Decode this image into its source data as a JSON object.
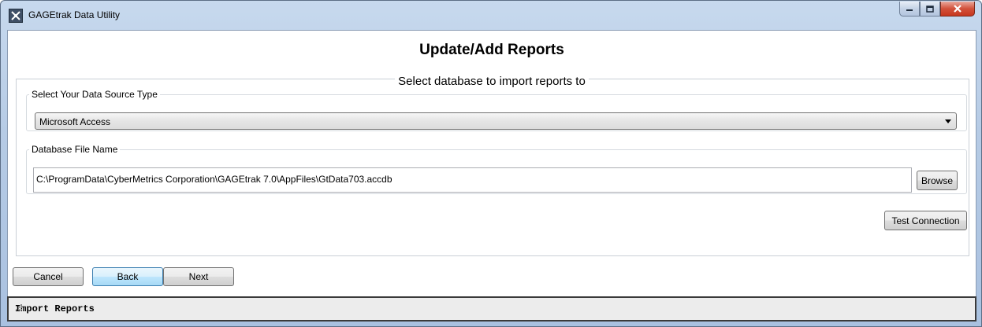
{
  "window": {
    "title": "GAGEtrak Data Utility",
    "icon": "tool-app-icon",
    "controls": [
      "minimize-icon",
      "maximize-icon",
      "close-icon"
    ]
  },
  "page": {
    "title": "Update/Add Reports",
    "subtitle": "Select database to import reports to"
  },
  "datasource": {
    "label": "Select Your Data Source Type",
    "selected": "Microsoft Access"
  },
  "database": {
    "label": "Database File Name",
    "value": "C:\\ProgramData\\CyberMetrics Corporation\\GAGEtrak 7.0\\AppFiles\\GtData703.accdb",
    "browse_label": "Browse"
  },
  "test_connection_label": "Test Connection",
  "nav": {
    "cancel": "Cancel",
    "back": "Back",
    "next": "Next"
  },
  "status": {
    "text": "Import Reports"
  },
  "colors": {
    "title_bar": "#b9cde6",
    "close_button": "#c7361e",
    "default_button_border": "#3c7fb1",
    "status_bar_border": "#3a3a3a"
  }
}
